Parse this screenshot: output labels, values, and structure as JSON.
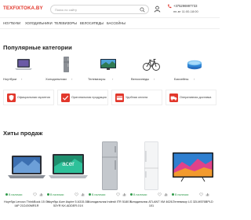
{
  "header": {
    "logo": "TEXFIXTOKA.BY",
    "search_placeholder": "Поиск по сайту",
    "phone": "+375296997733",
    "hours": "пн-вт 11:00-18:00"
  },
  "nav": {
    "items": [
      "НОУТБУКИ",
      "ХОЛОДИЛЬНИКИ",
      "ТЕЛЕВИЗОРЫ",
      "ВЕЛОСИПЕДЫ",
      "БАССЕЙНЫ"
    ]
  },
  "categories": {
    "title": "Популярные категории",
    "items": [
      {
        "label": "Ноутбуки",
        "icon": "laptop-icon"
      },
      {
        "label": "Холодильники",
        "icon": "fridge-icon"
      },
      {
        "label": "Телевизоры",
        "icon": "tv-icon"
      },
      {
        "label": "Велосипеды",
        "icon": "bicycle-icon"
      },
      {
        "label": "Бассейны",
        "icon": "pool-icon"
      }
    ]
  },
  "advantages": {
    "items": [
      {
        "label": "Официальная гарантия"
      },
      {
        "label": "Оригинальная продукция"
      },
      {
        "label": "Удобная оплата"
      },
      {
        "label": "Оперативная доставка"
      }
    ]
  },
  "bestsellers": {
    "title": "Хиты продаж",
    "products": [
      {
        "stock": "В наличии",
        "name": "Ноутбук Lenovo ThinkBook 15 G4 IAP 21DJ00MR1R"
      },
      {
        "stock": "В наличии",
        "name": "Ноутбук Acer Aspire 5 A315-58-53YR NX.ADDER.01X"
      },
      {
        "stock": "В наличии",
        "name": "Холодильник Indesit ITR 5180 S"
      },
      {
        "stock": "В наличии",
        "name": "Холодильник ATLANT ХМ 4626-101"
      },
      {
        "stock": "В наличии",
        "name": "Телевизор LG 32LM576BPLD"
      }
    ]
  },
  "colors": {
    "brand": "#e2372b",
    "accent": "#e2372b",
    "in_stock": "#2e9a49"
  }
}
